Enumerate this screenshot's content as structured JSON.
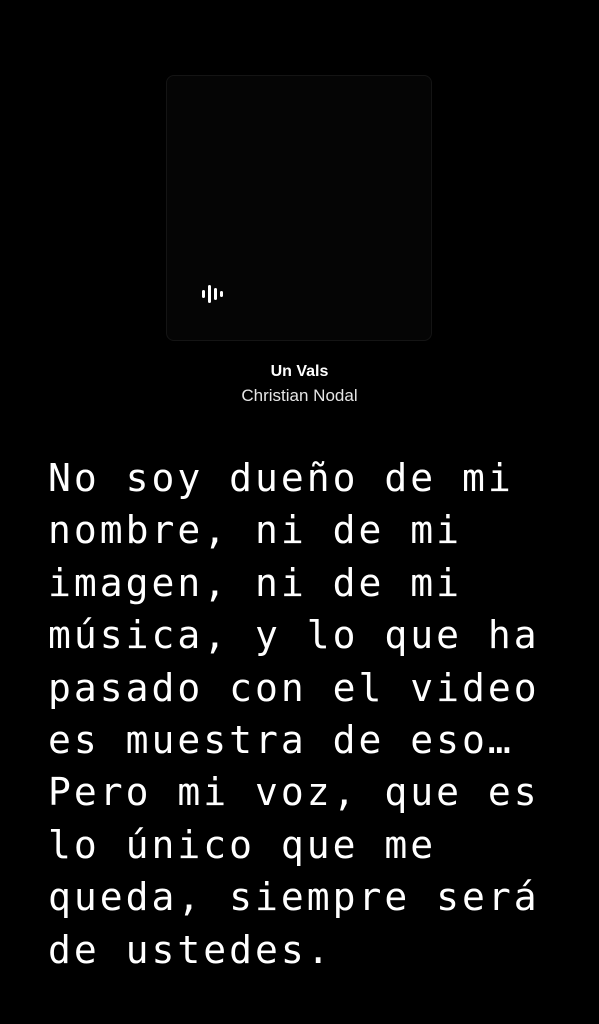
{
  "now_playing": {
    "icon": "waveform-icon",
    "title": "Un Vals",
    "artist": "Christian Nodal"
  },
  "story": {
    "text": "No soy dueño de mi\nnombre, ni de mi\nimagen, ni de mi\nmúsica, y lo que ha\npasado con el video\nes muestra de eso…\nPero mi voz, que es\nlo único que me\nqueda, siempre será\nde ustedes."
  },
  "colors": {
    "background": "#000000",
    "text": "#ffffff"
  }
}
